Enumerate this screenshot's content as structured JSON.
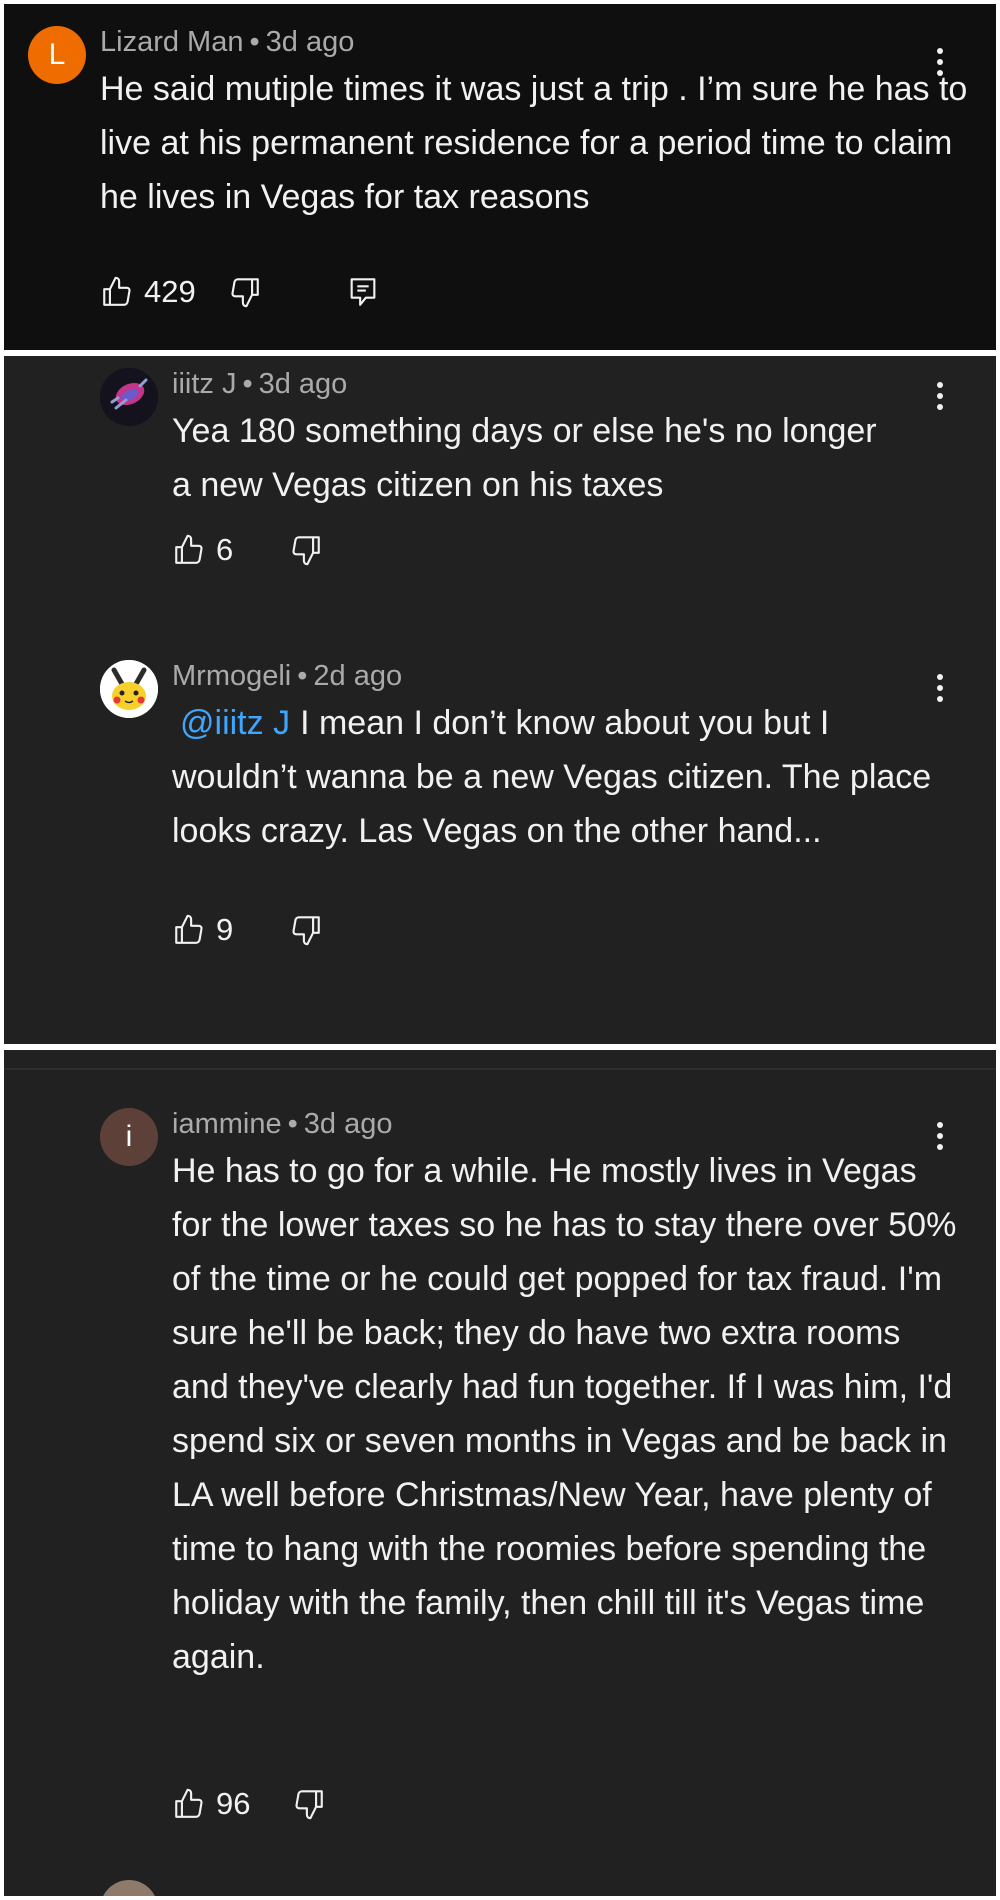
{
  "comments": [
    {
      "author": "Lizard Man",
      "time": "3d ago",
      "avatar_letter": "L",
      "avatar_color": "#ef6c00",
      "text": "He said mutiple times it was just a trip . I’m sure he has to live at his permanent residence for a period time to claim he lives in Vegas for tax reasons",
      "likes": "429"
    },
    {
      "author": "iiitz J",
      "time": "3d ago",
      "text": "Yea 180 something days or else he's no longer a new Vegas citizen on his taxes",
      "likes": "6"
    },
    {
      "author": "Mrmogeli",
      "time": "2d ago",
      "mention": "@iiitz J",
      "text": "I mean I don’t know about you but I wouldn’t wanna be a new Vegas citizen. The place looks crazy. Las Vegas on the other hand...",
      "likes": "9"
    },
    {
      "author": "iammine",
      "time": "3d ago",
      "avatar_letter": "i",
      "avatar_color": "#5d4037",
      "text": "He has to go for a while. He mostly lives in Vegas for the lower taxes so he has to stay there over 50% of the time or he could get popped for tax fraud. I'm sure he'll be back; they do have two extra rooms and they've clearly had fun together. If I was him, I'd spend six or seven months in Vegas and be back in LA well before Christmas/New Year, have plenty of time to hang with the roomies before spending the holiday with the family, then chill till it's Vegas time again.",
      "likes": "96"
    }
  ],
  "separator": "•",
  "colors": {
    "background_top": "#0f0f0f",
    "background": "#212121",
    "text": "#f1f1f1",
    "meta": "#aaaaaa",
    "mention": "#3ea6ff"
  },
  "icons": {
    "like": "thumbs-up-icon",
    "dislike": "thumbs-down-icon",
    "reply": "reply-icon",
    "more": "more-vertical-icon"
  }
}
